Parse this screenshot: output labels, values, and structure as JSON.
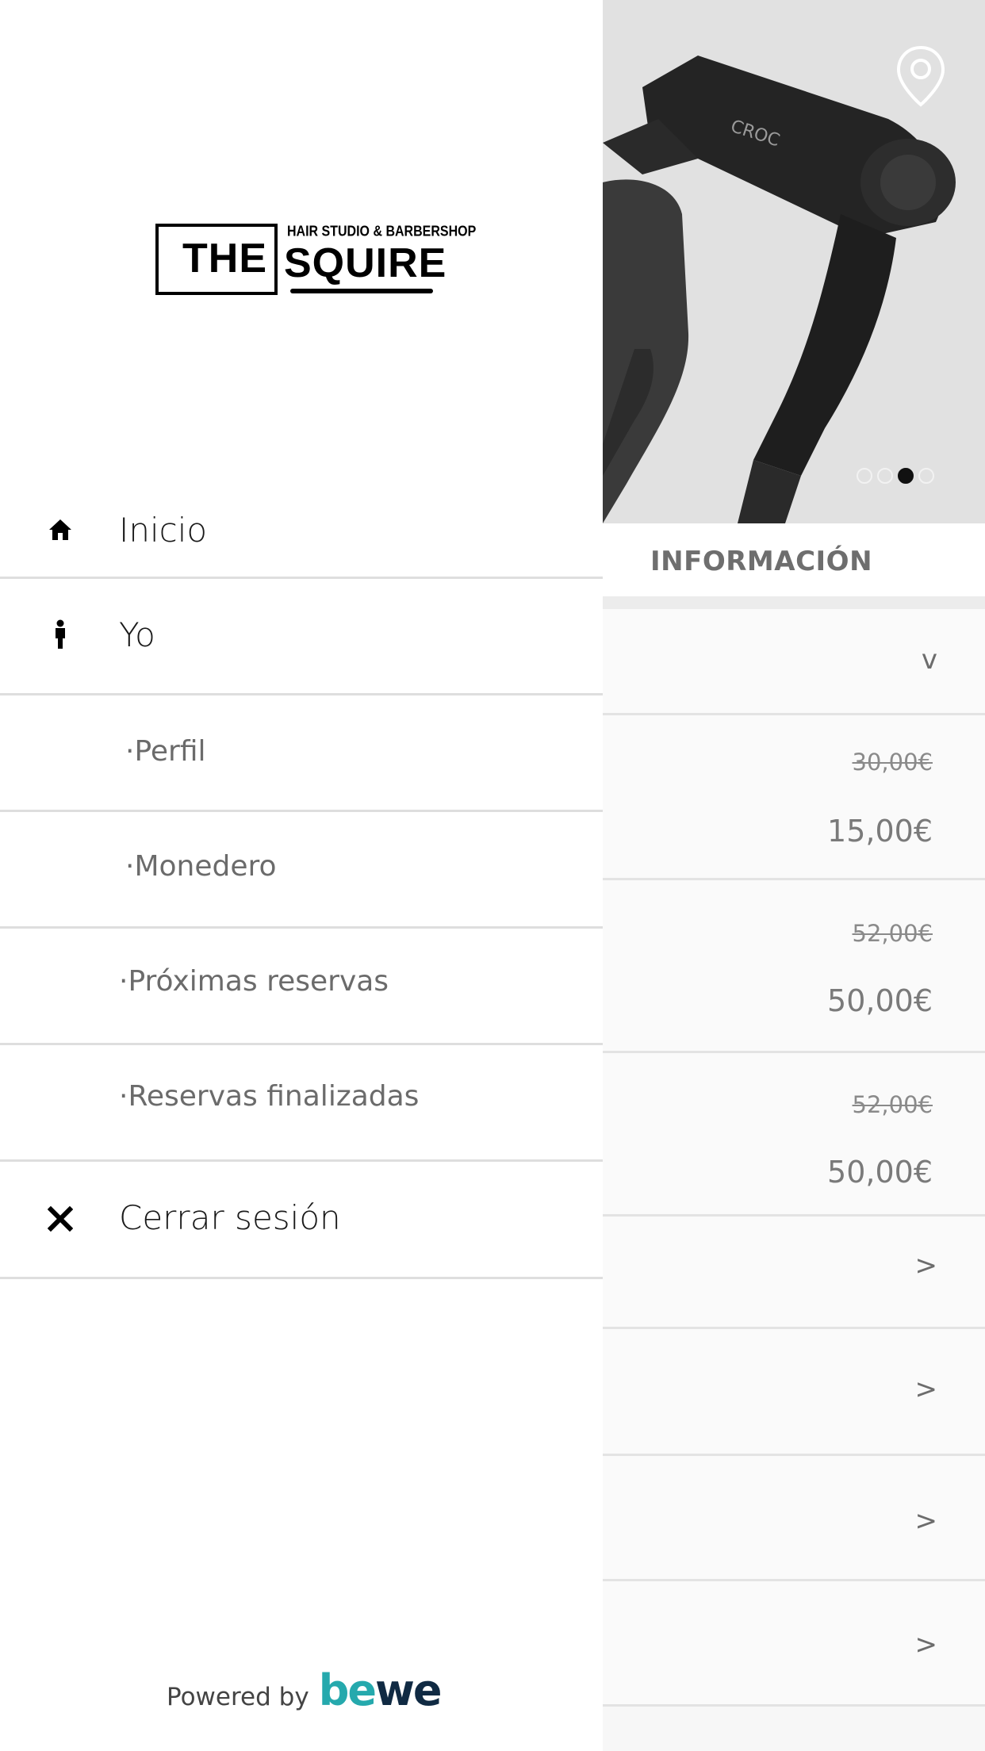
{
  "brand": {
    "logo_word_left": "THE",
    "logo_word_right": "SQUIRE",
    "logo_tagline": "HAIR STUDIO & BARBERSHOP"
  },
  "menu": {
    "inicio": "Inicio",
    "yo": "Yo",
    "perfil": "·Perfil",
    "monedero": "·Monedero",
    "proximas": "·Próximas reservas",
    "finalizadas": "·Reservas finalizadas",
    "cerrar": "Cerrar sesión"
  },
  "footer": {
    "powered_by": "Powered by",
    "bewe_be": "be",
    "bewe_we": "we"
  },
  "background": {
    "info_title": "INFORMACIÓN",
    "carousel": {
      "count": 4,
      "active_index": 2
    },
    "expand_glyph": "v",
    "chevron_glyph": ">",
    "prices": [
      {
        "old": "30,00€",
        "new": "15,00€"
      },
      {
        "old": "52,00€",
        "new": "50,00€"
      },
      {
        "old": "52,00€",
        "new": "50,00€"
      }
    ]
  },
  "colors": {
    "bewe_teal": "#25a9ad",
    "bewe_navy": "#102a43",
    "divider": "#dedede"
  }
}
